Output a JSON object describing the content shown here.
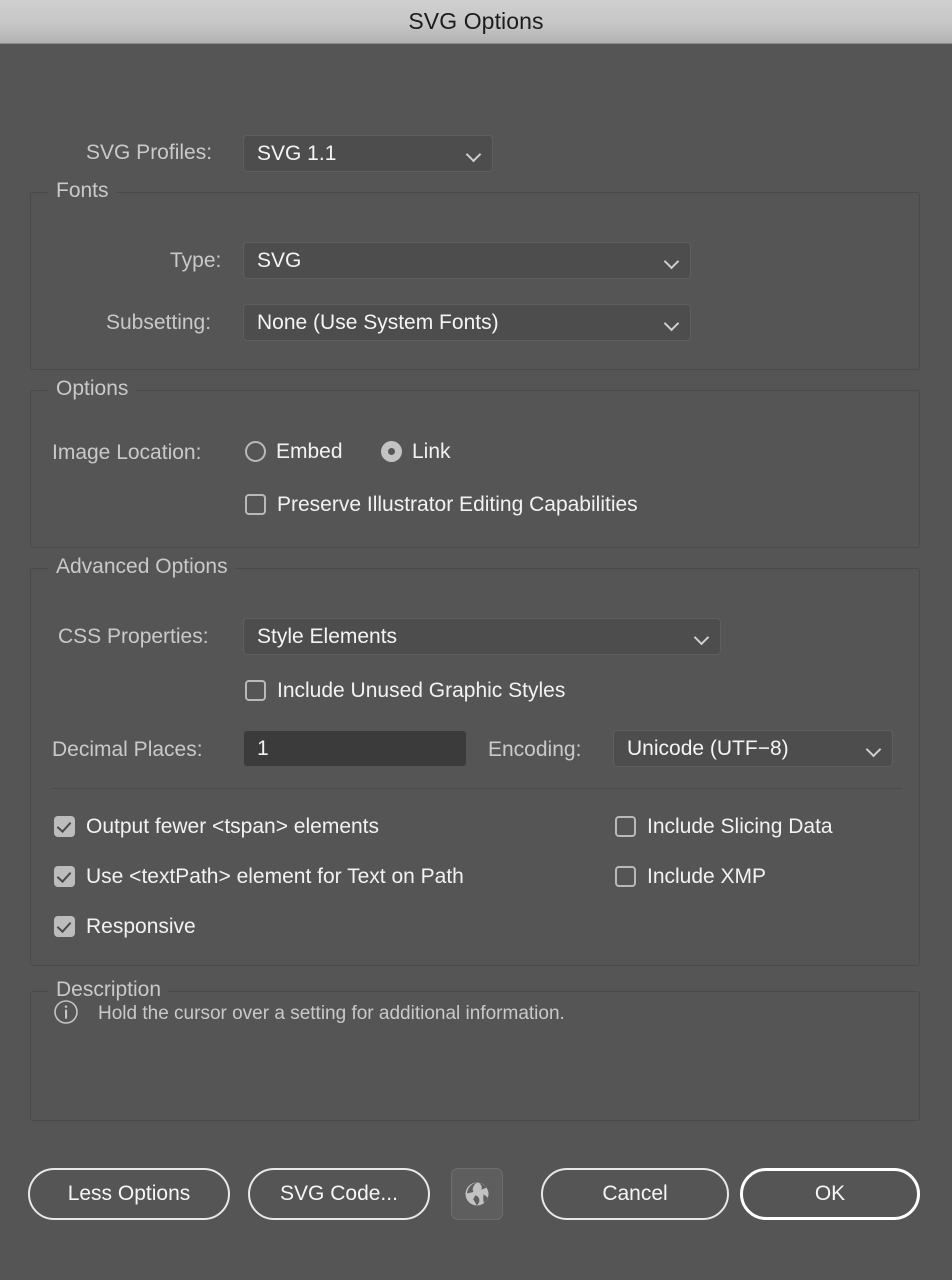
{
  "window": {
    "title": "SVG Options"
  },
  "colors": {
    "dialog_bg": "#555555",
    "titlebar_bg": "#c6c6c6",
    "text": "#f2f2f2",
    "label": "#c9c9c9",
    "control_bg": "#4d4d4d",
    "input_bg": "#3b3b3b",
    "checked": "#bcbcbc"
  },
  "profile_row": {
    "label": "SVG Profiles:",
    "value": "SVG 1.1"
  },
  "fonts_group": {
    "title": "Fonts",
    "type_label": "Type:",
    "type_value": "SVG",
    "subsetting_label": "Subsetting:",
    "subsetting_value": "None (Use System Fonts)"
  },
  "options_group": {
    "title": "Options",
    "image_location_label": "Image Location:",
    "radios": [
      {
        "label": "Embed",
        "checked": false
      },
      {
        "label": "Link",
        "checked": true
      }
    ],
    "preserve_checkbox": {
      "label": "Preserve Illustrator Editing Capabilities",
      "checked": false
    }
  },
  "advanced_group": {
    "title": "Advanced Options",
    "css_label": "CSS Properties:",
    "css_value": "Style Elements",
    "unused_styles_checkbox": {
      "label": "Include Unused Graphic Styles",
      "checked": false
    },
    "decimal_label": "Decimal Places:",
    "decimal_value": "1",
    "encoding_label": "Encoding:",
    "encoding_value": "Unicode (UTF−8)",
    "checkboxes_left": [
      {
        "label": "Output fewer <tspan> elements",
        "checked": true
      },
      {
        "label": "Use <textPath> element for Text on Path",
        "checked": true
      },
      {
        "label": "Responsive",
        "checked": true
      }
    ],
    "checkboxes_right": [
      {
        "label": "Include Slicing Data",
        "checked": false
      },
      {
        "label": "Include XMP",
        "checked": false
      }
    ]
  },
  "description_group": {
    "title": "Description",
    "icon": "info-icon",
    "text": "Hold the cursor over a setting for additional information."
  },
  "footer": {
    "less_options": "Less Options",
    "svg_code": "SVG Code...",
    "preview_icon": "globe-icon",
    "cancel": "Cancel",
    "ok": "OK"
  }
}
